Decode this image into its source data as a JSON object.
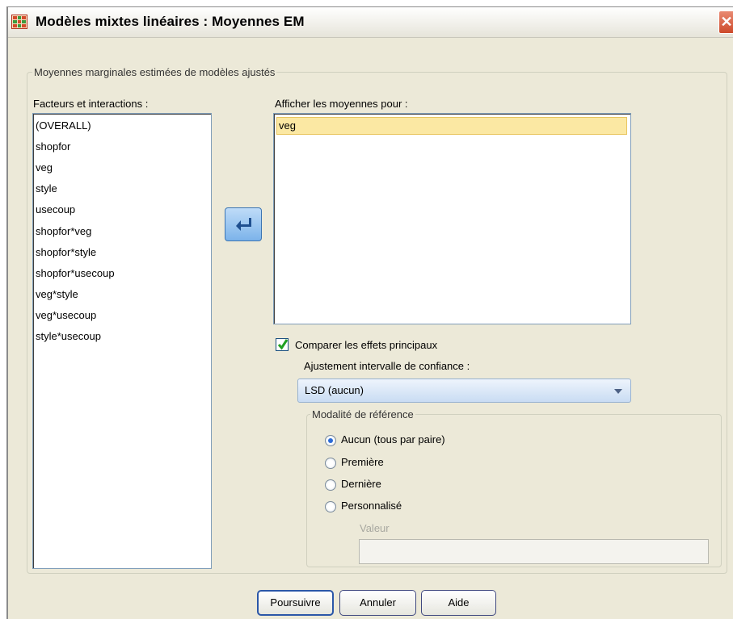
{
  "window": {
    "title": "Modèles mixtes linéaires : Moyennes EM"
  },
  "main_group": {
    "legend": "Moyennes marginales estimées de modèles ajustés"
  },
  "factors": {
    "label": "Facteurs et interactions :",
    "items": [
      "(OVERALL)",
      "shopfor",
      "veg",
      "style",
      "usecoup",
      "shopfor*veg",
      "shopfor*style",
      "shopfor*usecoup",
      "veg*style",
      "veg*usecoup",
      "style*usecoup"
    ]
  },
  "display_means": {
    "label": "Afficher les moyennes pour :",
    "items": [
      "veg"
    ]
  },
  "compare": {
    "label": "Comparer les effets principaux",
    "checked": true
  },
  "adjustment": {
    "label": "Ajustement intervalle de confiance :",
    "selected": "LSD (aucun)"
  },
  "reference": {
    "legend": "Modalité de référence",
    "options": [
      "Aucun (tous par paire)",
      "Première",
      "Dernière",
      "Personnalisé"
    ],
    "selected_index": 0,
    "value_label": "Valeur",
    "value": ""
  },
  "buttons": {
    "continue": "Poursuivre",
    "cancel": "Annuler",
    "help": "Aide"
  },
  "icons": {
    "move": "arrow-left-icon",
    "close": "close-icon"
  }
}
